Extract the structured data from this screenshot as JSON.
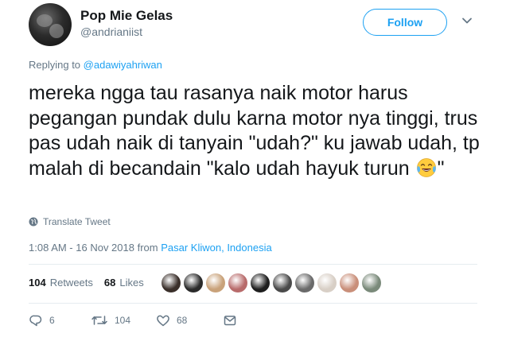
{
  "tweet": {
    "display_name": "Pop Mie Gelas",
    "handle": "@andrianiist",
    "follow_label": "Follow",
    "replying_prefix": "Replying to",
    "replying_handle": "@adawiyahriwan",
    "text_before_emoji": "mereka ngga tau rasanya naik motor harus pegangan pundak dulu karna motor nya tinggi, trus pas udah naik di tanyain \"udah?\" ku jawab udah, tp malah di becandain \"kalo udah hayuk turun ",
    "text_after_emoji": "\"",
    "emoji": "face-with-tears-of-joy",
    "translate_label": "Translate Tweet",
    "timestamp": "1:08 AM - 16 Nov 2018",
    "from_word": "from",
    "location": "Pasar Kliwon, Indonesia"
  },
  "stats": {
    "retweets_count": "104",
    "retweets_label": "Retweets",
    "likes_count": "68",
    "likes_label": "Likes"
  },
  "likers": [
    {
      "icon": "avatar-1",
      "color": "#3a2f2a"
    },
    {
      "icon": "avatar-2",
      "color": "#2b2b2b"
    },
    {
      "icon": "avatar-3",
      "color": "#c9a27a"
    },
    {
      "icon": "avatar-4",
      "color": "#b86b6b"
    },
    {
      "icon": "avatar-5",
      "color": "#1e1e1e"
    },
    {
      "icon": "avatar-6",
      "color": "#4a4a4a"
    },
    {
      "icon": "avatar-7",
      "color": "#6a6a6a"
    },
    {
      "icon": "avatar-8",
      "color": "#d8cfc6"
    },
    {
      "icon": "avatar-9",
      "color": "#c98f7a"
    },
    {
      "icon": "avatar-10",
      "color": "#7a8a7a"
    }
  ],
  "actions": {
    "reply_count": "6",
    "retweet_count": "104",
    "like_count": "68"
  },
  "colors": {
    "accent": "#1da1f2",
    "secondary_text": "#657786",
    "primary_text": "#14171a",
    "divider": "#e6ecf0"
  }
}
